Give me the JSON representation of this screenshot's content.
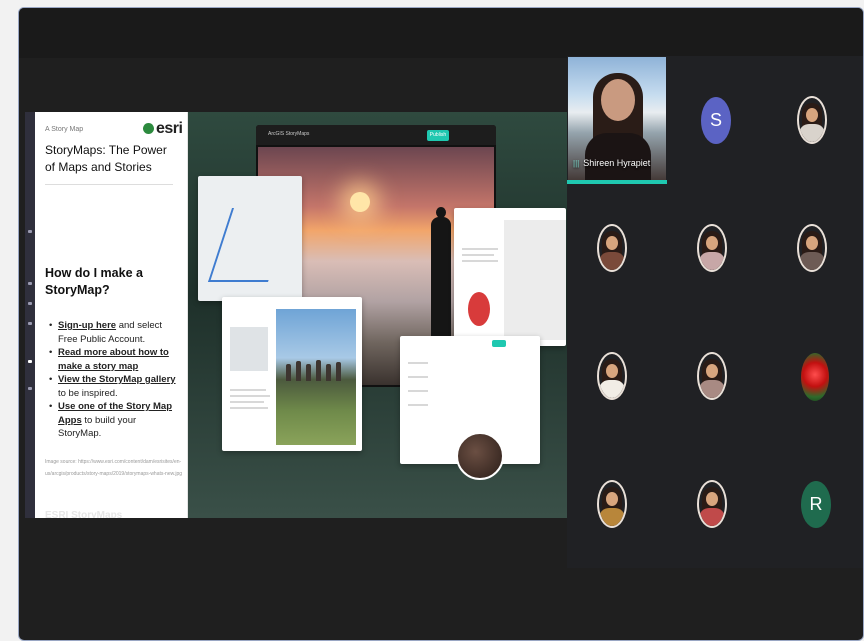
{
  "slide": {
    "breadcrumb": "A Story Map",
    "logo_text": "esri",
    "title": "StoryMaps: The Power of Maps and Stories",
    "heading": "How do I make a StoryMap?",
    "bullets": [
      {
        "link": "Sign-up here",
        "text": " and select Free Public Account."
      },
      {
        "link": "Read more about how to make a story map",
        "text": ""
      },
      {
        "link": "View the StoryMap gallery",
        "text": " to be inspired."
      },
      {
        "link": "Use one of the Story Map Apps",
        "text": " to build your StoryMap."
      }
    ],
    "image_credit": "Image source: https://www.esri.com/content/dam/esrisites/en-us/arcgis/products/story-maps/2019/storymaps-whats-new.jpg",
    "footer_faded": "ESRI StoryMaps",
    "collage": {
      "app_title": "ArcGIS StoryMaps",
      "publish_label": "Publish"
    }
  },
  "gallery": {
    "speaker": {
      "name": "Shireen Hyrapiet",
      "accent": "#1fc8b0"
    },
    "participants": [
      {
        "type": "letter",
        "letter": "S",
        "color": "#5b63c4"
      },
      {
        "type": "photo",
        "shirt": "#d9d3cc"
      },
      {
        "type": "photo",
        "shirt": "#7a4a3a"
      },
      {
        "type": "photo",
        "shirt": "#c7a7a7"
      },
      {
        "type": "photo",
        "shirt": "#6d5b55"
      },
      {
        "type": "photo",
        "shirt": "#f1ede6"
      },
      {
        "type": "photo",
        "shirt": "#a88a83"
      },
      {
        "type": "flower"
      },
      {
        "type": "photo",
        "shirt": "#b8863a"
      },
      {
        "type": "photo",
        "shirt": "#c04a4a"
      },
      {
        "type": "letter",
        "letter": "R",
        "color": "#1f6b4e"
      }
    ]
  }
}
